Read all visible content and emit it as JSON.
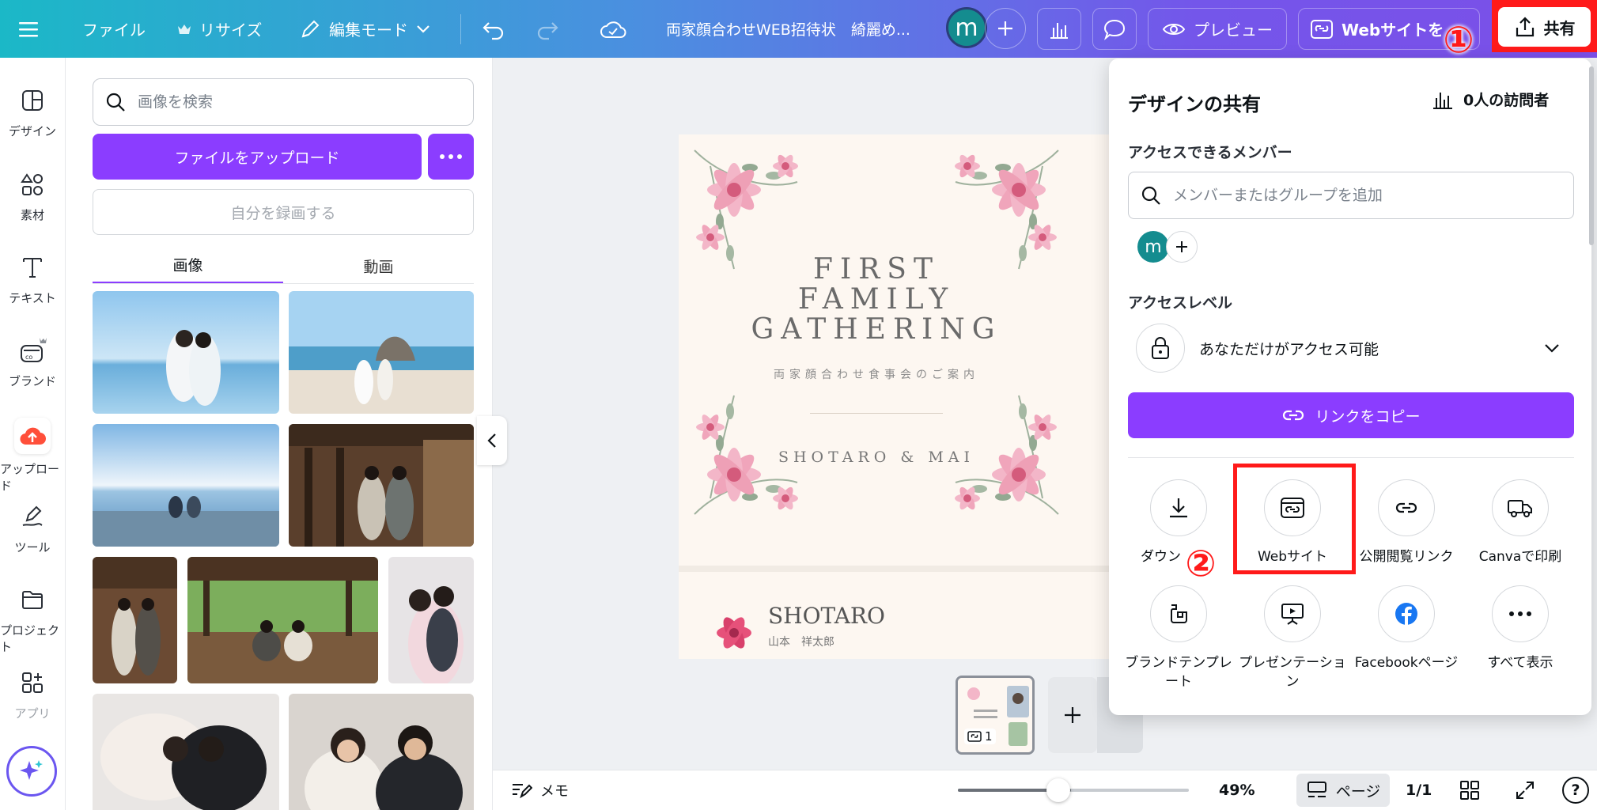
{
  "topbar": {
    "file": "ファイル",
    "resize": "リサイズ",
    "edit_mode": "編集モード",
    "doc_title": "両家顔合わせWEB招待状　綺麗め...",
    "avatar_letter": "m",
    "preview": "プレビュー",
    "website": "Webサイトを",
    "share": "共有"
  },
  "annotations": {
    "first": "①",
    "second": "②"
  },
  "rail": {
    "items": [
      {
        "label": "デザイン",
        "icon": "layout-icon"
      },
      {
        "label": "素材",
        "icon": "elements-icon"
      },
      {
        "label": "テキスト",
        "icon": "text-icon"
      },
      {
        "label": "ブランド",
        "icon": "brand-icon"
      },
      {
        "label": "アップロード",
        "icon": "upload-cloud-icon"
      },
      {
        "label": "ツール",
        "icon": "draw-tool-icon"
      },
      {
        "label": "プロジェクト",
        "icon": "folder-icon"
      },
      {
        "label": "アプリ",
        "icon": "apps-icon"
      }
    ]
  },
  "panel": {
    "search_placeholder": "画像を検索",
    "upload": "ファイルをアップロード",
    "record": "自分を録画する",
    "tabs": [
      "画像",
      "動画"
    ]
  },
  "invitation": {
    "title_lines": [
      "FIRST",
      "FAMILY",
      "GATHERING"
    ],
    "subtitle": "両家顔合わせ食事会のご案内",
    "names": "SHOTARO & MAI",
    "groom": "SHOTARO",
    "groom_jp": "山本　祥太郎"
  },
  "thumbnail": {
    "page_number": "1"
  },
  "bottom": {
    "memo": "メモ",
    "zoom": "49%",
    "zoom_fraction": 0.49,
    "pages_label": "ページ",
    "page_count": "1/1",
    "help": "?"
  },
  "share_popover": {
    "title": "デザインの共有",
    "visitors": "0人の訪問者",
    "members_label": "アクセスできるメンバー",
    "members_placeholder": "メンバーまたはグループを追加",
    "member_letter": "m",
    "access_label": "アクセスレベル",
    "access_value": "あなただけがアクセス可能",
    "copy_link": "リンクをコピー",
    "options": [
      {
        "label": "ダウン",
        "icon": "download-icon"
      },
      {
        "label": "Webサイト",
        "icon": "website-icon"
      },
      {
        "label": "公開閲覧リンク",
        "icon": "link-icon"
      },
      {
        "label": "Canvaで印刷",
        "icon": "truck-icon"
      },
      {
        "label": "ブランドテンプレート",
        "icon": "brand-template-icon"
      },
      {
        "label": "プレゼンテーション",
        "icon": "presentation-icon"
      },
      {
        "label": "Facebookページ",
        "icon": "facebook-icon"
      },
      {
        "label": "すべて表示",
        "icon": "more-icon"
      }
    ]
  },
  "colors": {
    "accent": "#8b3dff",
    "highlight": "#ff1a1a",
    "avatar": "#148c8f"
  }
}
